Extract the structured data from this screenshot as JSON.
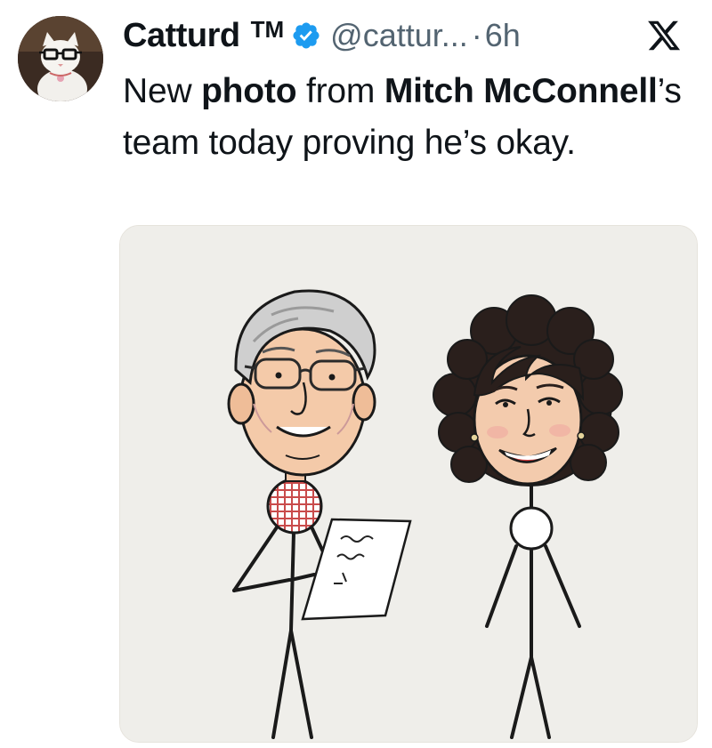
{
  "tweet": {
    "author_name": "Catturd",
    "trademark": "TM",
    "handle": "@cattur...",
    "separator": "·",
    "timestamp": "6h",
    "text_parts": {
      "p1": "New ",
      "p2": "photo",
      "p3": " from ",
      "p4": "Mitch McConnell",
      "p5": "’s team today proving he’s okay."
    }
  },
  "icons": {
    "verified": "verified-badge-icon",
    "platform": "x-logo-icon",
    "avatar": "cat-with-glasses-avatar"
  },
  "colors": {
    "verified_blue": "#1d9bf0",
    "text": "#0f1419",
    "secondary_text": "#536471",
    "media_background": "#efeeea"
  }
}
